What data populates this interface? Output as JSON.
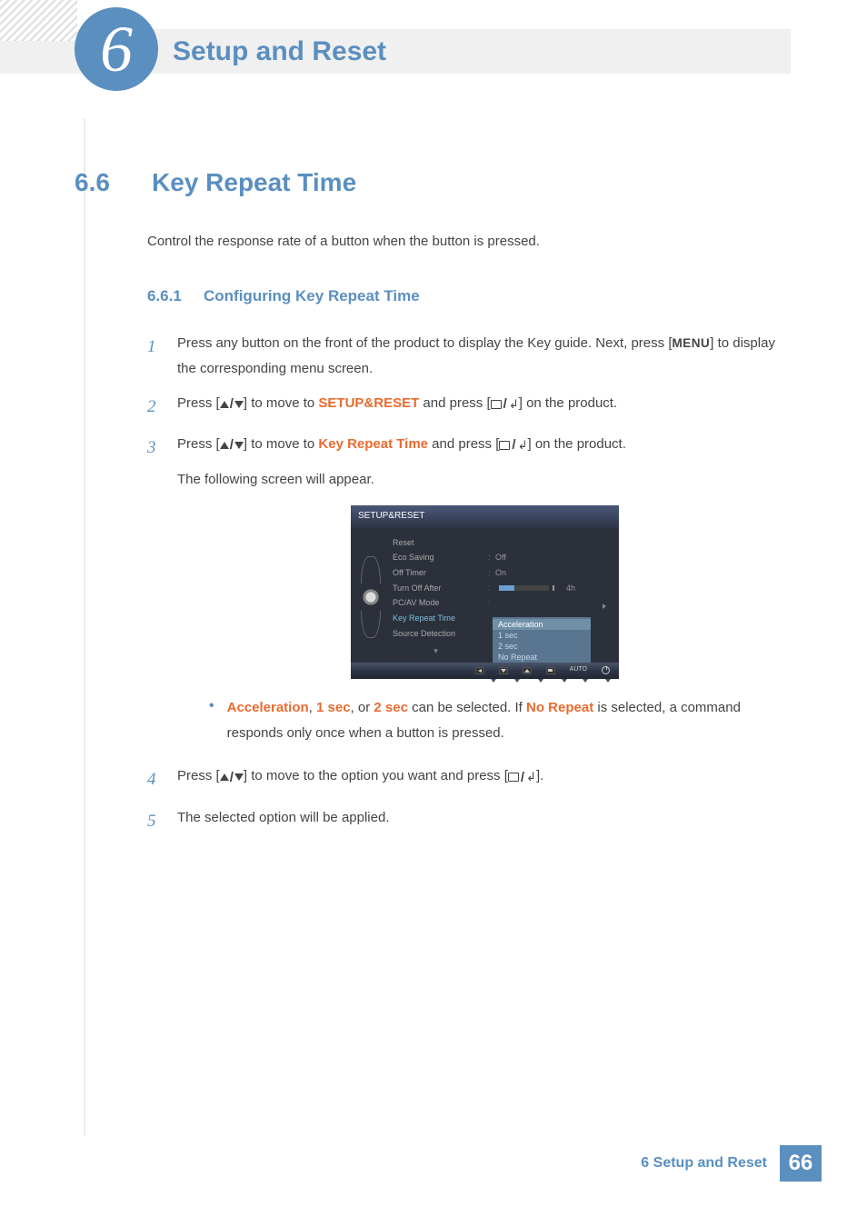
{
  "header": {
    "chapter_number": "6",
    "chapter_title": "Setup and Reset"
  },
  "section": {
    "number": "6.6",
    "title": "Key Repeat Time",
    "intro": "Control the response rate of a button when the button is pressed."
  },
  "subsection": {
    "number": "6.6.1",
    "title": "Configuring Key Repeat Time"
  },
  "steps": {
    "s1": {
      "num": "1",
      "pre": "Press any button on the front of the product to display the Key guide. Next, press [",
      "menu": "MENU",
      "post": "] to display the corresponding menu screen."
    },
    "s2": {
      "num": "2",
      "a": "Press [",
      "b": "] to move to ",
      "target": "SETUP&RESET",
      "c": " and press [",
      "d": "] on the product."
    },
    "s3": {
      "num": "3",
      "a": "Press [",
      "b": "] to move to ",
      "target": "Key Repeat Time",
      "c": " and press [",
      "d": "] on the product.",
      "following": "The following screen will appear."
    },
    "bullet": {
      "opt1": "Acceleration",
      "sep1": ", ",
      "opt2": "1 sec",
      "sep2": ", or ",
      "opt3": "2 sec",
      "mid": " can be selected. If ",
      "opt4": "No Repeat",
      "post": " is selected, a command responds only once when a button is pressed."
    },
    "s4": {
      "num": "4",
      "a": "Press [",
      "b": "] to move to the option you want and press [",
      "c": "]."
    },
    "s5": {
      "num": "5",
      "text": "The selected option will be applied."
    }
  },
  "osd": {
    "title": "SETUP&RESET",
    "items": {
      "reset": "Reset",
      "eco": "Eco Saving",
      "offtimer": "Off Timer",
      "turnoff": "Turn Off After",
      "pcav": "PC/AV Mode",
      "keyrepeat": "Key Repeat Time",
      "source": "Source Detection"
    },
    "values": {
      "eco": "Off",
      "offtimer": "On",
      "turnoff_hours": "4h"
    },
    "dropdown": {
      "opt1": "Acceleration",
      "opt2": "1 sec",
      "opt3": "2 sec",
      "opt4": "No Repeat"
    },
    "auto": "AUTO"
  },
  "footer": {
    "text": "6 Setup and Reset",
    "page": "66"
  }
}
